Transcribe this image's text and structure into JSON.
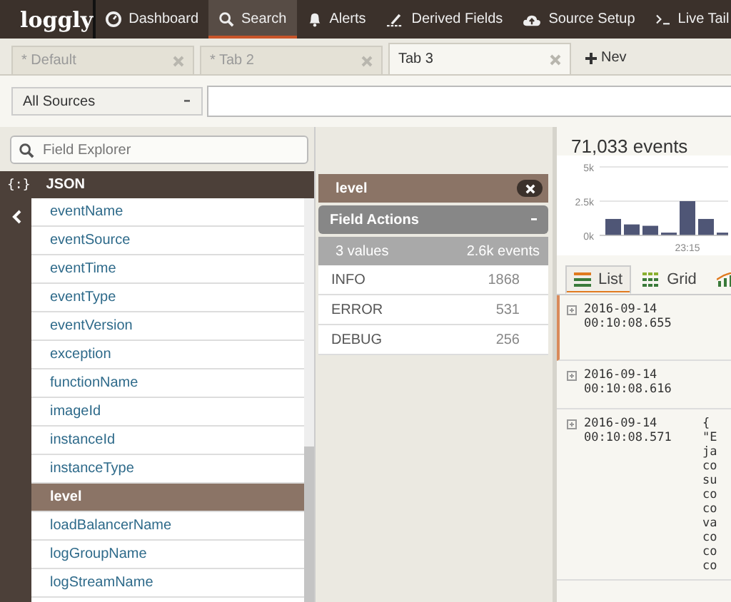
{
  "nav": {
    "logo": "loggly",
    "items": [
      {
        "label": "Dashboard",
        "selected": false
      },
      {
        "label": "Search",
        "selected": true
      },
      {
        "label": "Alerts",
        "selected": false
      },
      {
        "label": "Derived Fields",
        "selected": false
      },
      {
        "label": "Source Setup",
        "selected": false
      },
      {
        "label": "Live Tail",
        "selected": false
      }
    ]
  },
  "tabs": [
    {
      "label": "* Default",
      "selected": false
    },
    {
      "label": "* Tab 2",
      "selected": false
    },
    {
      "label": "Tab 3",
      "selected": true
    }
  ],
  "new_tab": "Nev",
  "source_select": "All Sources",
  "field_explorer": {
    "placeholder": "Field Explorer",
    "group_icon": "{:}",
    "group": "JSON",
    "fields": [
      {
        "name": "eventName",
        "selected": false
      },
      {
        "name": "eventSource",
        "selected": false
      },
      {
        "name": "eventTime",
        "selected": false
      },
      {
        "name": "eventType",
        "selected": false
      },
      {
        "name": "eventVersion",
        "selected": false
      },
      {
        "name": "exception",
        "selected": false
      },
      {
        "name": "functionName",
        "selected": false
      },
      {
        "name": "imageId",
        "selected": false
      },
      {
        "name": "instanceId",
        "selected": false
      },
      {
        "name": "instanceType",
        "selected": false
      },
      {
        "name": "level",
        "selected": true
      },
      {
        "name": "loadBalancerName",
        "selected": false
      },
      {
        "name": "logGroupName",
        "selected": false
      },
      {
        "name": "logStreamName",
        "selected": false
      }
    ]
  },
  "field_panel": {
    "title": "level",
    "actions": "Field Actions",
    "values_count": "3 values",
    "events_count": "2.6k events",
    "values": [
      {
        "name": "INFO",
        "count": "1868"
      },
      {
        "name": "ERROR",
        "count": "531"
      },
      {
        "name": "DEBUG",
        "count": "256"
      }
    ]
  },
  "events": {
    "total": "71,033 events",
    "chart_data": {
      "type": "bar",
      "categories": [
        null,
        null,
        null,
        null,
        "23:15",
        null,
        null
      ],
      "values": [
        1200,
        800,
        700,
        200,
        2500,
        1200,
        200
      ],
      "ylim": [
        0,
        5000
      ],
      "yticks": [
        {
          "value": 0,
          "label": "0k"
        },
        {
          "value": 2500,
          "label": "2.5k"
        },
        {
          "value": 5000,
          "label": "5k"
        }
      ]
    },
    "view_tabs": [
      {
        "label": "List",
        "selected": true
      },
      {
        "label": "Grid",
        "selected": false
      },
      {
        "selected": false
      }
    ],
    "entries": [
      {
        "date": "2016-09-14",
        "time": "00:10:08.655",
        "selected": true
      },
      {
        "date": "2016-09-14",
        "time": "00:10:08.616",
        "selected": false
      },
      {
        "date": "2016-09-14",
        "time": "00:10:08.571",
        "selected": false,
        "message": [
          "{",
          "\"E",
          "ja",
          "co",
          "su",
          "co",
          "co",
          "va",
          "co",
          "co",
          "co"
        ]
      }
    ]
  }
}
